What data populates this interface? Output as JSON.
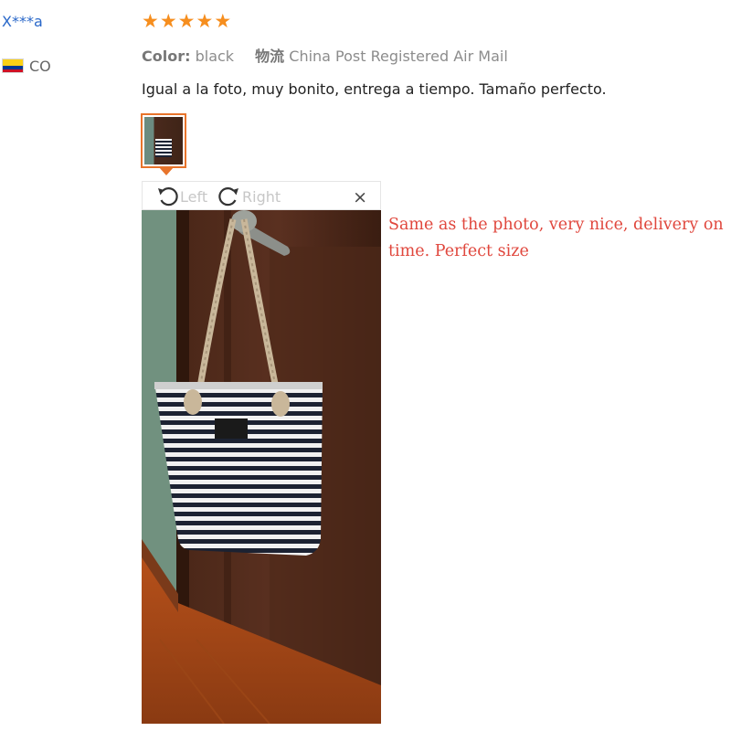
{
  "reviewer": {
    "name": "X***a",
    "country_code": "CO",
    "flag_colors": [
      "#fcd116",
      "#003893",
      "#ce1126"
    ]
  },
  "review": {
    "rating": 5,
    "star_color": "#f68e1e",
    "color_label": "Color:",
    "color_value": "black",
    "shipping_label": "物流",
    "shipping_value": "China Post Registered Air Mail",
    "text": "Igual a la foto, muy bonito, entrega a tiempo. Tamaño perfecto.",
    "translation": "Same as the photo, very nice, delivery on time. Perfect size"
  },
  "viewer": {
    "rotate_left_label": "Left",
    "rotate_right_label": "Right",
    "close_label": "×",
    "accent_color": "#e8742b"
  }
}
